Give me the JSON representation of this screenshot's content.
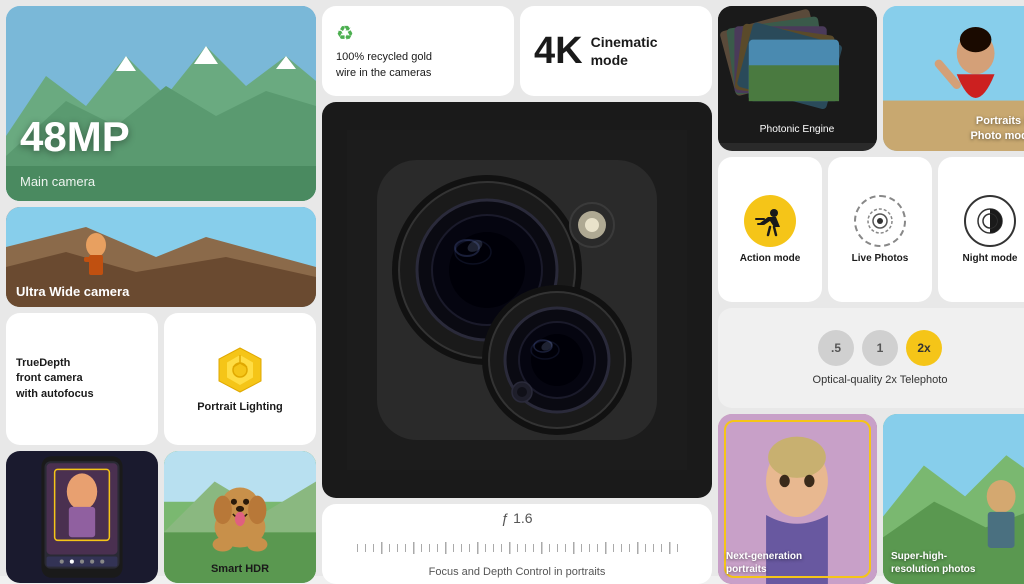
{
  "left": {
    "mp_label": "48MP",
    "main_camera": "Main camera",
    "ultrawide": "Ultra Wide camera",
    "truedepth": "TrueDepth\nfront camera\nwith autofocus",
    "portrait_lighting": "Portrait Lighting",
    "smart_hdr": "Smart HDR"
  },
  "middle": {
    "recycled_text": "100% recycled gold\nwire in the cameras",
    "four_k": "4K",
    "cinematic": "Cinematic\nmode",
    "aperture": "ƒ 1.6",
    "focus_label": "Focus and Depth Control in portraits"
  },
  "right": {
    "photonic_engine": "Photonic Engine",
    "portraits_photo": "Portraits in\nPhoto mode",
    "action_mode": "Action mode",
    "live_photos": "Live Photos",
    "night_mode": "Night mode",
    "telephoto_label": "Optical-quality 2x Telephoto",
    "zoom_05": ".5",
    "zoom_1": "1",
    "zoom_2x": "2x",
    "next_gen": "Next-generation\nportraits",
    "super_res": "Super-high-\nresolution photos"
  }
}
